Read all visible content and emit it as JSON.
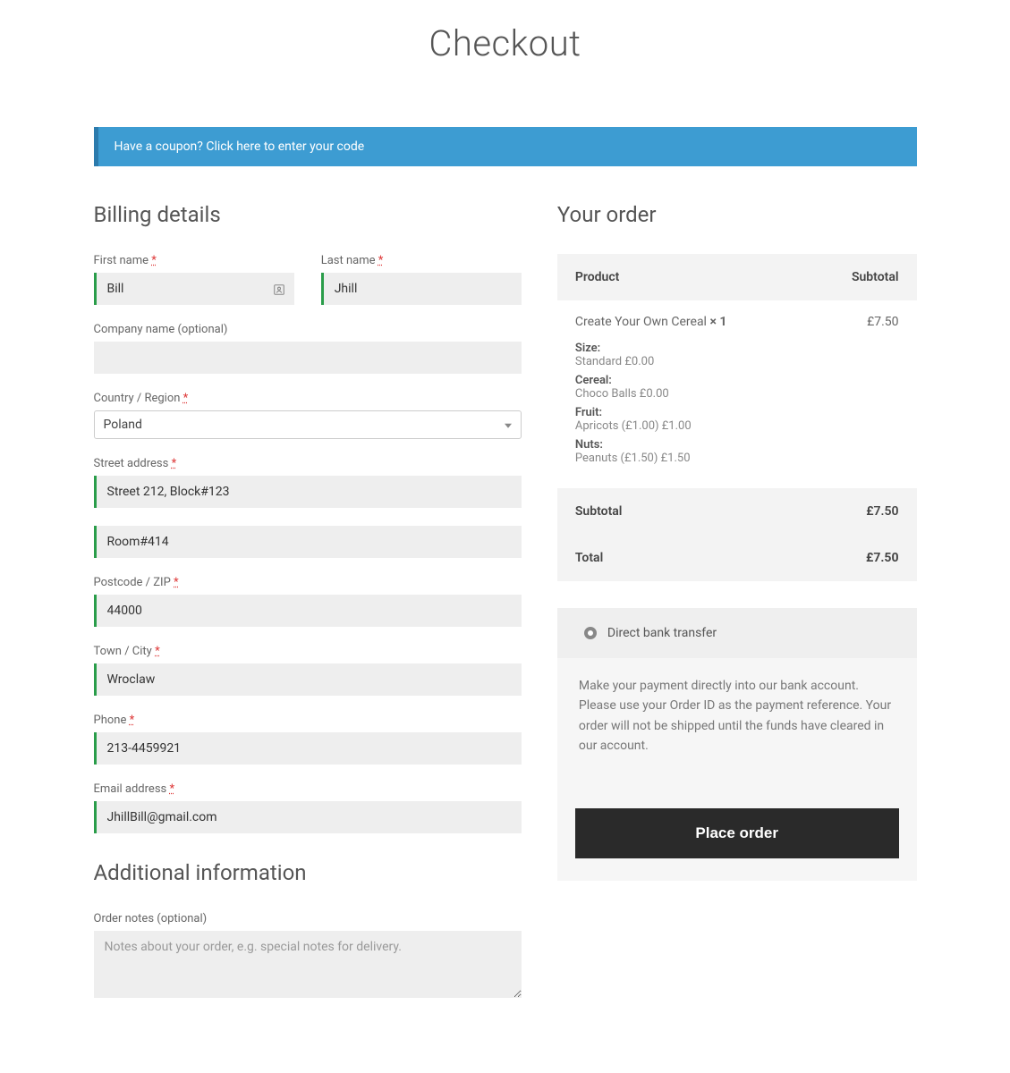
{
  "page_title": "Checkout",
  "coupon_banner": {
    "prefix": "Have a coupon? ",
    "link_text": "Click here to enter your code"
  },
  "billing": {
    "heading": "Billing details",
    "fields": {
      "first_name": {
        "label": "First name",
        "value": "Bill",
        "required": true
      },
      "last_name": {
        "label": "Last name",
        "value": "Jhill",
        "required": true
      },
      "company": {
        "label": "Company name (optional)",
        "value": "",
        "required": false
      },
      "country": {
        "label": "Country / Region",
        "value": "Poland",
        "required": true
      },
      "street1": {
        "label": "Street address",
        "value": "Street 212, Block#123",
        "required": true
      },
      "street2": {
        "value": "Room#414"
      },
      "postcode": {
        "label": "Postcode / ZIP",
        "value": "44000",
        "required": true
      },
      "city": {
        "label": "Town / City",
        "value": "Wroclaw",
        "required": true
      },
      "phone": {
        "label": "Phone",
        "value": "213-4459921",
        "required": true
      },
      "email": {
        "label": "Email address",
        "value": "JhillBill@gmail.com",
        "required": true
      }
    }
  },
  "additional": {
    "heading": "Additional information",
    "notes_label": "Order notes (optional)",
    "notes_placeholder": "Notes about your order, e.g. special notes for delivery."
  },
  "order": {
    "heading": "Your order",
    "columns": {
      "product": "Product",
      "subtotal": "Subtotal"
    },
    "item": {
      "name": "Create Your Own Cereal ",
      "qty": "× 1",
      "price": "£7.50",
      "attrs": [
        {
          "label": "Size:",
          "value": "Standard £0.00"
        },
        {
          "label": "Cereal:",
          "value": "Choco Balls £0.00"
        },
        {
          "label": "Fruit:",
          "value": "Apricots (£1.00) £1.00"
        },
        {
          "label": "Nuts:",
          "value": "Peanuts (£1.50) £1.50"
        }
      ]
    },
    "subtotal_label": "Subtotal",
    "subtotal_value": "£7.50",
    "total_label": "Total",
    "total_value": "£7.50"
  },
  "payment": {
    "option_label": "Direct bank transfer",
    "description": "Make your payment directly into our bank account. Please use your Order ID as the payment reference. Your order will not be shipped until the funds have cleared in our account.",
    "button": "Place order"
  },
  "required_marker": "*"
}
